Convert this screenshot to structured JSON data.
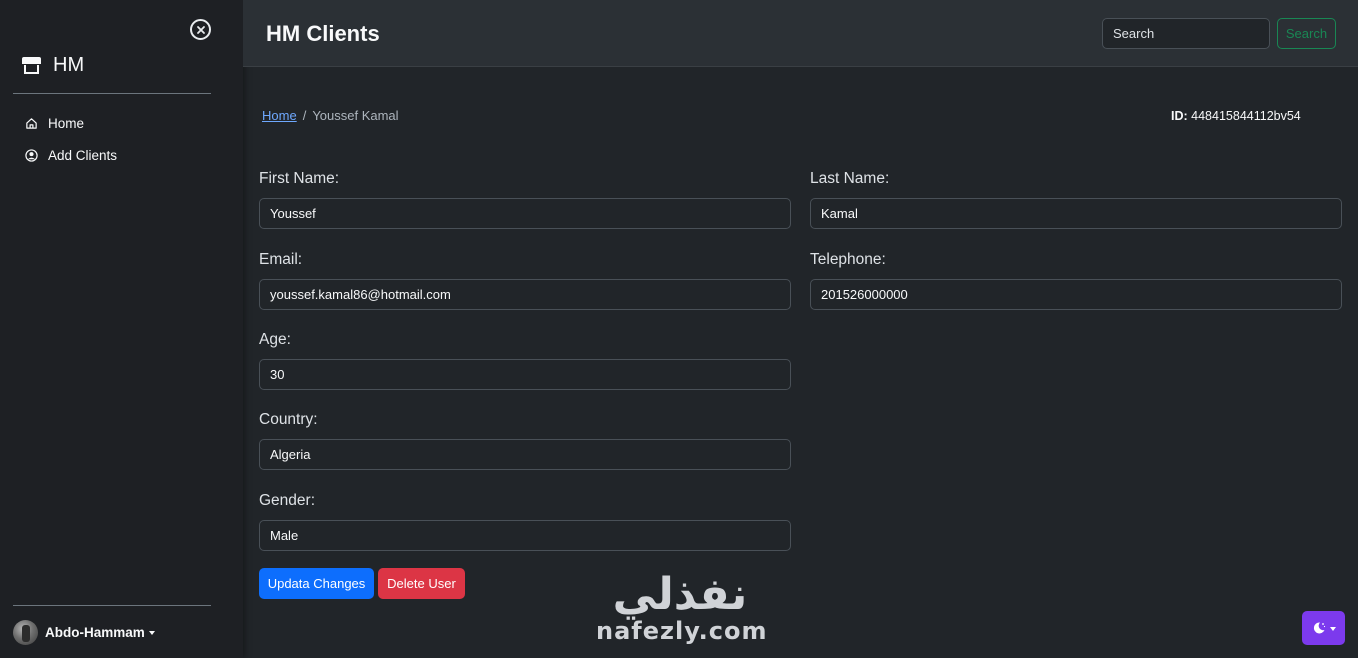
{
  "sidebar": {
    "brand": "HM",
    "items": [
      {
        "label": "Home",
        "icon": "home-icon"
      },
      {
        "label": "Add Clients",
        "icon": "user-circle-icon"
      }
    ],
    "user": "Abdo-Hammam"
  },
  "header": {
    "title": "HM Clients",
    "search_placeholder": "Search",
    "search_button": "Search"
  },
  "breadcrumb": {
    "home": "Home",
    "separator": "/",
    "current": "Youssef Kamal"
  },
  "client": {
    "id_label": "ID:",
    "id_value": "448415844112bv54"
  },
  "form": {
    "first_name": {
      "label": "First Name:",
      "value": "Youssef"
    },
    "last_name": {
      "label": "Last Name:",
      "value": "Kamal"
    },
    "email": {
      "label": "Email:",
      "value": "youssef.kamal86@hotmail.com"
    },
    "telephone": {
      "label": "Telephone:",
      "value": "201526000000"
    },
    "age": {
      "label": "Age:",
      "value": "30"
    },
    "country": {
      "label": "Country:",
      "value": "Algeria"
    },
    "gender": {
      "label": "Gender:",
      "value": "Male"
    }
  },
  "actions": {
    "update": "Updata Changes",
    "delete": "Delete User"
  },
  "watermark": {
    "arabic": "نفذلي",
    "latin": "nafezly.com"
  },
  "colors": {
    "primary": "#0d6efd",
    "danger": "#dc3545",
    "success": "#198754",
    "theme_toggle": "#7c3aed"
  }
}
